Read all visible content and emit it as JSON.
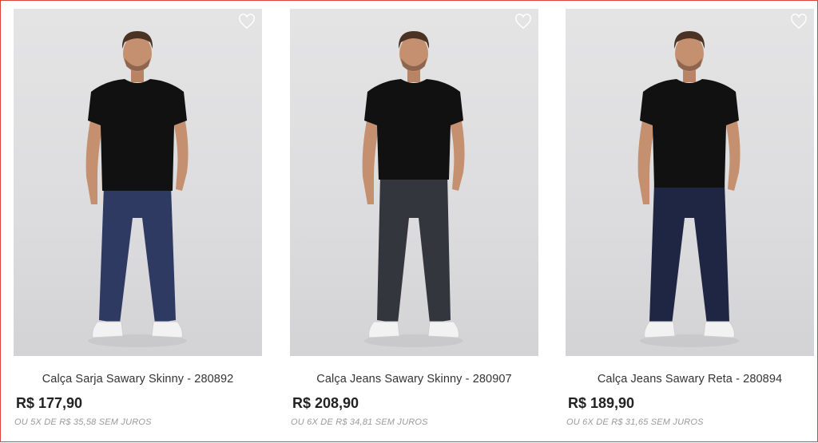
{
  "products": [
    {
      "name": "Calça Sarja Sawary Skinny - 280892",
      "price": "R$ 177,90",
      "installments": "ou 5x de R$ 35,58 sem juros",
      "pants_color": "#2f3a63",
      "favorite_icon": "heart-outline-icon"
    },
    {
      "name": "Calça Jeans Sawary Skinny - 280907",
      "price": "R$ 208,90",
      "installments": "ou 6x de R$ 34,81 sem juros",
      "pants_color": "#34363d",
      "favorite_icon": "heart-outline-icon"
    },
    {
      "name": "Calça Jeans Sawary Reta - 280894",
      "price": "R$ 189,90",
      "installments": "ou 6x de R$ 31,65 sem juros",
      "pants_color": "#1e2643",
      "favorite_icon": "heart-outline-icon"
    }
  ],
  "colors": {
    "shirt": "#111111",
    "skin": "#c4906f",
    "hair": "#4a3324",
    "shoe": "#f2f2f2",
    "background": "#dedee0",
    "frame_border": "#d9453c"
  }
}
